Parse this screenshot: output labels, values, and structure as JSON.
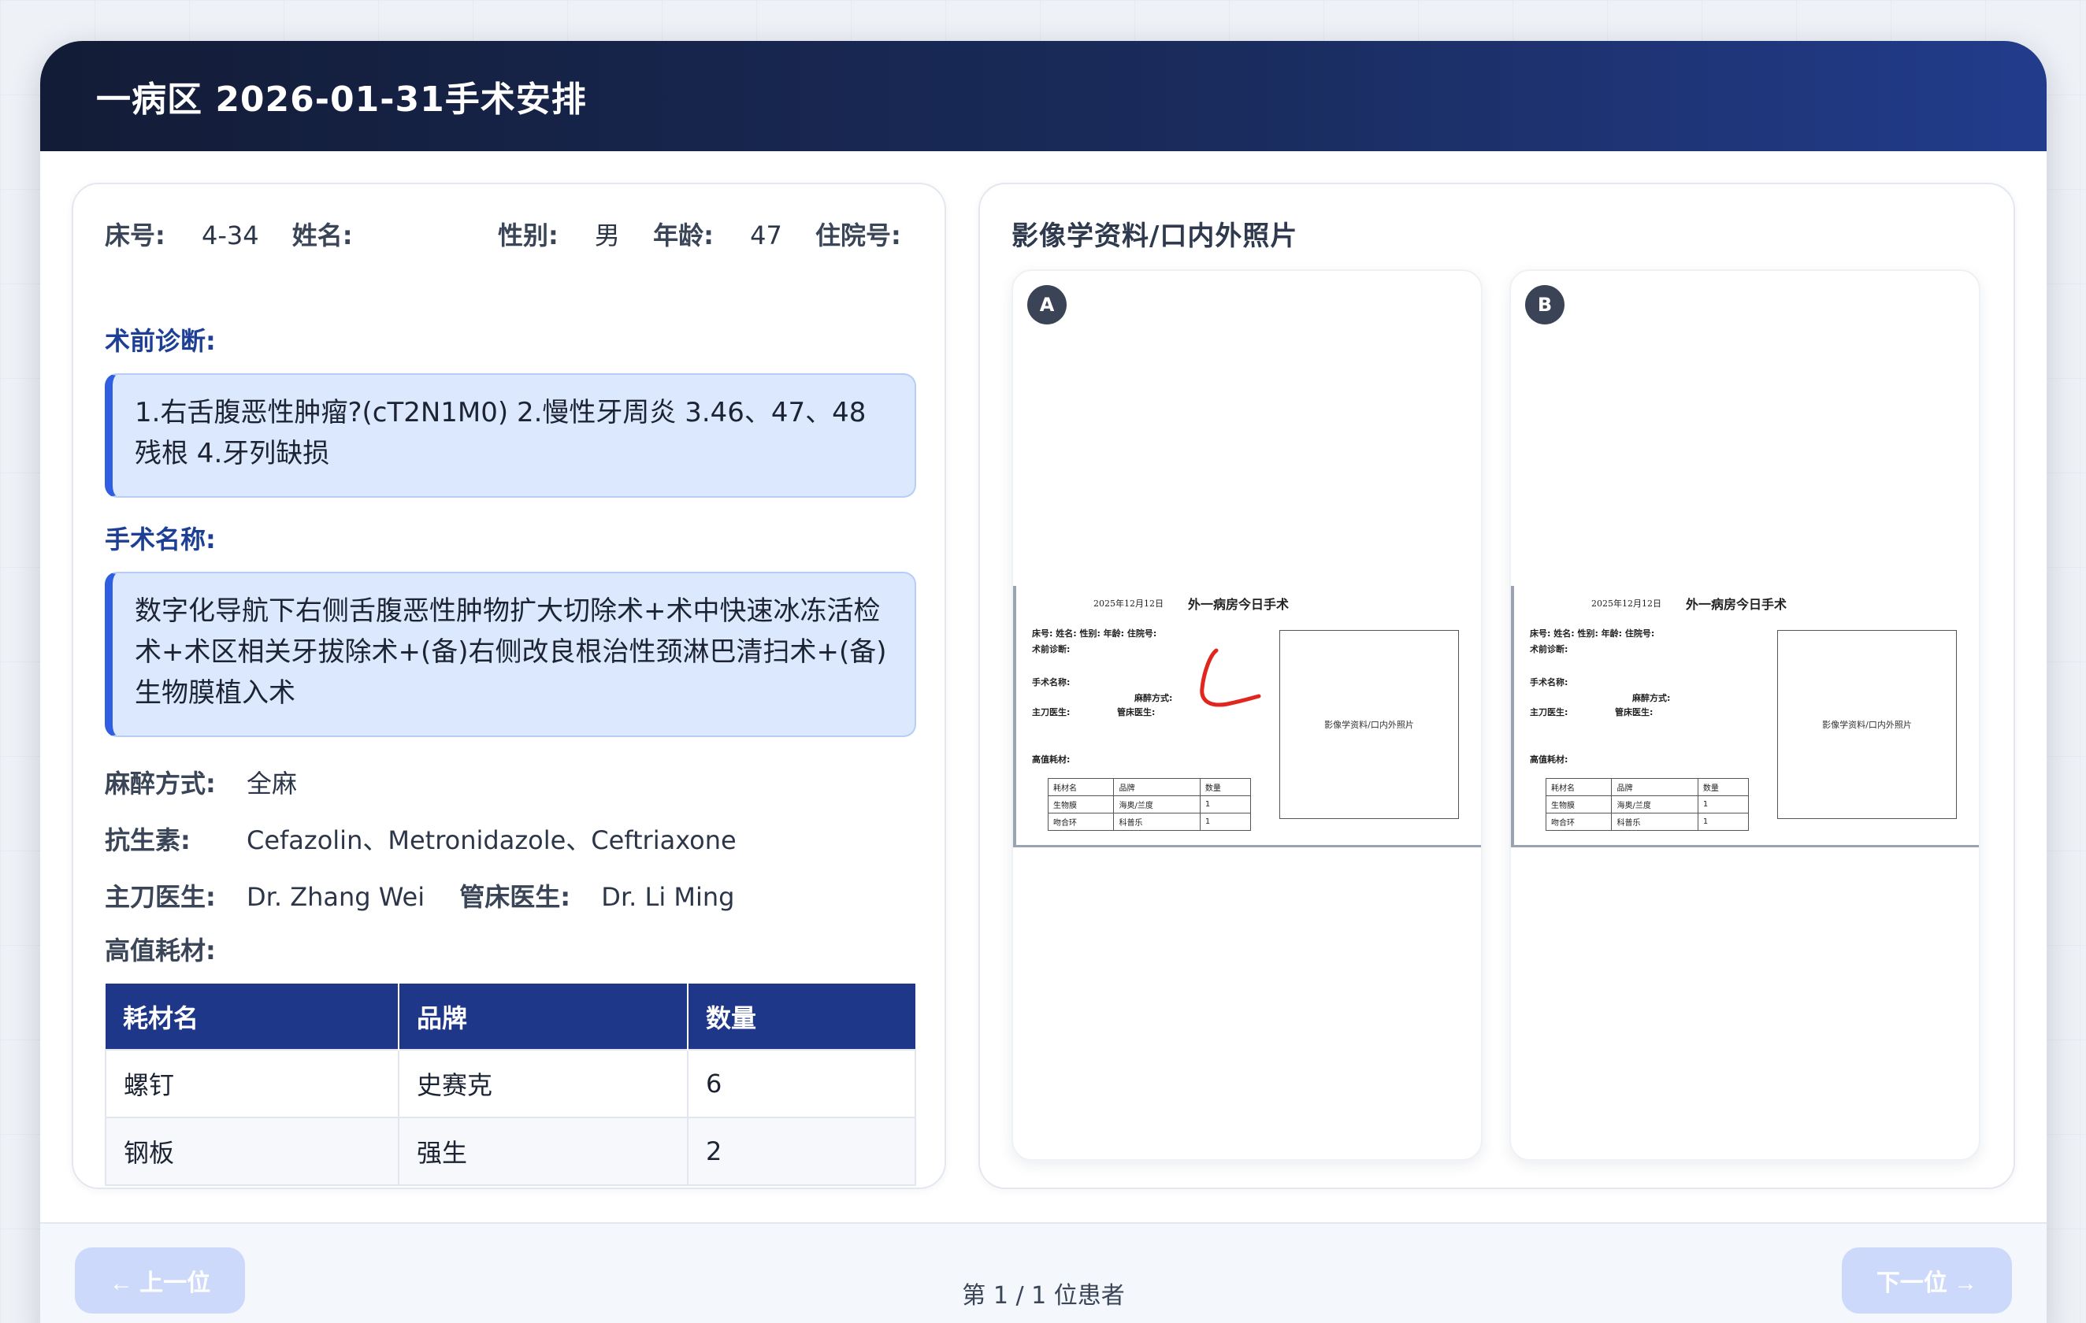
{
  "modal": {
    "title": "一病区 2026-01-31手术安排"
  },
  "patient": {
    "bed_label": "床号:",
    "bed": "4-34",
    "name_label": "姓名:",
    "name": "",
    "gender_label": "性别:",
    "gender": "男",
    "age_label": "年龄:",
    "age": "47",
    "admission_label": "住院号:",
    "admission": ""
  },
  "diagnosis": {
    "title": "术前诊断:",
    "text": "1.右舌腹恶性肿瘤?(cT2N1M0) 2.慢性牙周炎 3.46、47、48残根 4.牙列缺损"
  },
  "surgery": {
    "title": "手术名称:",
    "text": "数字化导航下右侧舌腹恶性肿物扩大切除术+术中快速冰冻活检术+术区相关牙拔除术+(备)右侧改良根治性颈淋巴清扫术+(备) 生物膜植入术"
  },
  "anesthesia": {
    "label": "麻醉方式:",
    "value": "全麻"
  },
  "antibiotic": {
    "label": "抗生素:",
    "value": "Cefazolin、Metronidazole、Ceftriaxone"
  },
  "doctors": {
    "surgeon_label": "主刀医生:",
    "surgeon": "Dr. Zhang Wei",
    "bed_doctor_label": "管床医生:",
    "bed_doctor": "Dr. Li Ming"
  },
  "consumables": {
    "title": "高值耗材:",
    "headers": [
      "耗材名",
      "品牌",
      "数量"
    ],
    "rows": [
      [
        "螺钉",
        "史赛克",
        "6"
      ],
      [
        "钢板",
        "强生",
        "2"
      ]
    ]
  },
  "imaging": {
    "title": "影像学资料/口内外照片",
    "photos": [
      {
        "badge": "A",
        "doc": {
          "date": "2025年12月12日",
          "heading": "外一病房今日手术",
          "fields_line": "床号:  姓名:  性别:  年龄:  住院号:",
          "diag": "术前诊断:",
          "surg": "手术名称:",
          "anes": "麻醉方式:",
          "surgeon": "主刀医生:",
          "beddoc": "管床医生:",
          "cons": "高值耗材:",
          "image_label": "影像学资料/口内外照片",
          "table": [
            [
              "耗材名",
              "品牌",
              "数量"
            ],
            [
              "生物膜",
              "海奥/兰度",
              "1"
            ],
            [
              "吻合环",
              "科普乐",
              "1"
            ]
          ]
        }
      },
      {
        "badge": "B",
        "doc": {
          "date": "2025年12月12日",
          "heading": "外一病房今日手术",
          "fields_line": "床号:  姓名:  性别:  年龄:  住院号:",
          "diag": "术前诊断:",
          "surg": "手术名称:",
          "anes": "麻醉方式:",
          "surgeon": "主刀医生:",
          "beddoc": "管床医生:",
          "cons": "高值耗材:",
          "image_label": "影像学资料/口内外照片",
          "table": [
            [
              "耗材名",
              "品牌",
              "数量"
            ],
            [
              "生物膜",
              "海奥/兰度",
              "1"
            ],
            [
              "吻合环",
              "科普乐",
              "1"
            ]
          ]
        }
      }
    ]
  },
  "footer": {
    "prev_label": "← 上一位",
    "next_label": "下一位 →",
    "pager": "第 1 / 1 位患者"
  },
  "colors": {
    "header_dark": "#131c36",
    "accent_blue": "#1f3788",
    "highlight_bg": "#dce8fd",
    "annotation_red": "#e0261d"
  }
}
